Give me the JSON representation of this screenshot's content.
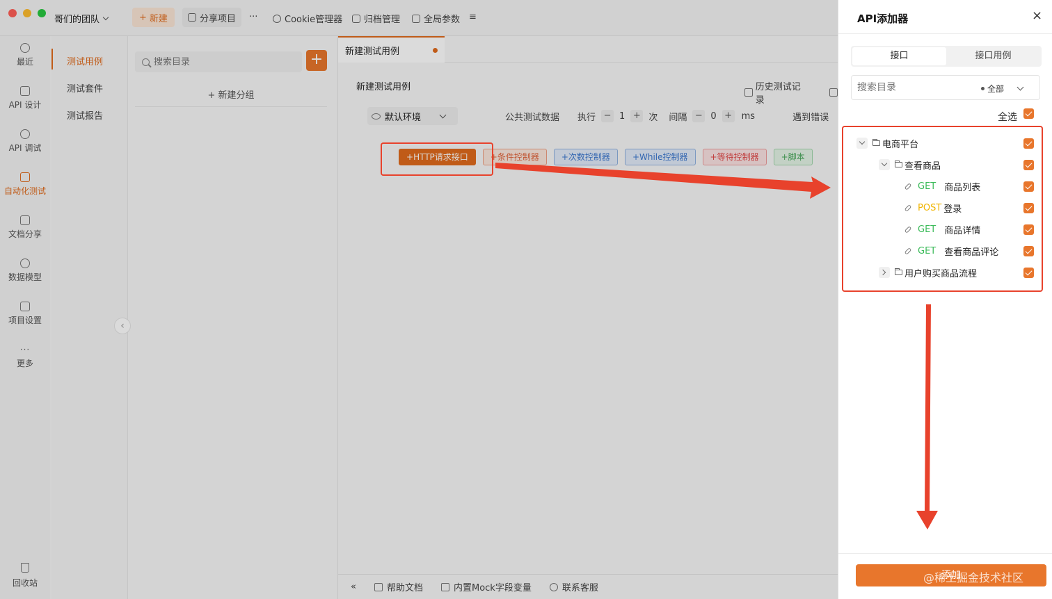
{
  "titlebar": {
    "team": "哥们的团队",
    "new_label": "新建",
    "share_label": "分享项目",
    "more": "···",
    "cookie_label": "Cookie管理器",
    "archive_label": "归档管理",
    "global_params_label": "全局参数"
  },
  "leftnav": {
    "items": [
      {
        "label": "最近",
        "icon": "clock-icon"
      },
      {
        "label": "API 设计",
        "icon": "api-design-icon"
      },
      {
        "label": "API 调试",
        "icon": "api-debug-icon"
      },
      {
        "label": "自动化测试",
        "icon": "automation-icon"
      },
      {
        "label": "文档分享",
        "icon": "doc-share-icon"
      },
      {
        "label": "数据模型",
        "icon": "data-model-icon"
      },
      {
        "label": "项目设置",
        "icon": "project-settings-icon"
      },
      {
        "label": "更多",
        "icon": "more-icon"
      }
    ],
    "active_index": 3,
    "trash_label": "回收站",
    "accent": "#e06b1c"
  },
  "subnav": {
    "items": [
      "测试用例",
      "测试套件",
      "测试报告"
    ]
  },
  "tree": {
    "search_placeholder": "搜索目录",
    "add_symbol": "+",
    "new_group": "新建分组"
  },
  "main": {
    "tab_label": "新建测试用例",
    "case_title": "新建测试用例",
    "history_label": "历史测试记录",
    "env_label": "默认环境",
    "public_data_label": "公共测试数据",
    "exec_label": "执行",
    "exec_count": "1",
    "times_label": "次",
    "interval_label": "间隔",
    "interval_value": "0",
    "ms_label": "ms",
    "on_error_label": "遇到错误",
    "controls": [
      "HTTP请求接口",
      "条件控制器",
      "次数控制器",
      "While控制器",
      "等待控制器",
      "脚本"
    ]
  },
  "footer": {
    "help_docs": "帮助文档",
    "mock_vars": "内置Mock字段变量",
    "support": "联系客服"
  },
  "drawer": {
    "title": "API添加器",
    "close": "×",
    "tabs": [
      "接口",
      "接口用例"
    ],
    "active_tab": 0,
    "search_placeholder": "搜索目录",
    "filter_label": "全部",
    "select_all": "全选",
    "tree": {
      "root": "电商平台",
      "folder": "查看商品",
      "apis": [
        {
          "method": "GET",
          "name": "商品列表"
        },
        {
          "method": "POST",
          "name": "登录"
        },
        {
          "method": "GET",
          "name": "商品详情"
        },
        {
          "method": "GET",
          "name": "查看商品评论"
        }
      ],
      "collapsed_folder": "用户购买商品流程"
    },
    "add_button": "添加",
    "watermark": "@稀土掘金技术社区",
    "accent": "#e8762c",
    "annotation_color": "#e8422c"
  }
}
